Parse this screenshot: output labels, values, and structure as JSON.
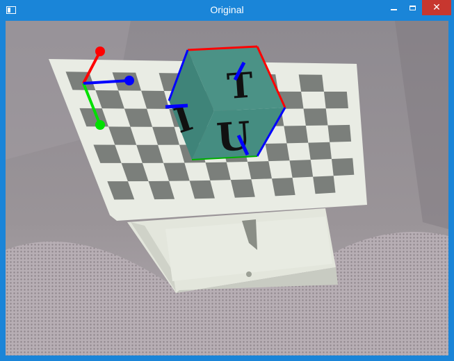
{
  "window": {
    "title": "Original",
    "minimize_icon": "minimize-icon",
    "maximize_icon": "maximize-icon",
    "close_icon": "close-icon",
    "close_color": "#c7372f"
  },
  "scene": {
    "cube_letters": {
      "top": "T",
      "left": "I",
      "front": "U"
    },
    "colors": {
      "cube_face": "#4b9286",
      "axis_x": "#ff0000",
      "axis_y": "#00e000",
      "axis_z": "#0000ff"
    }
  }
}
